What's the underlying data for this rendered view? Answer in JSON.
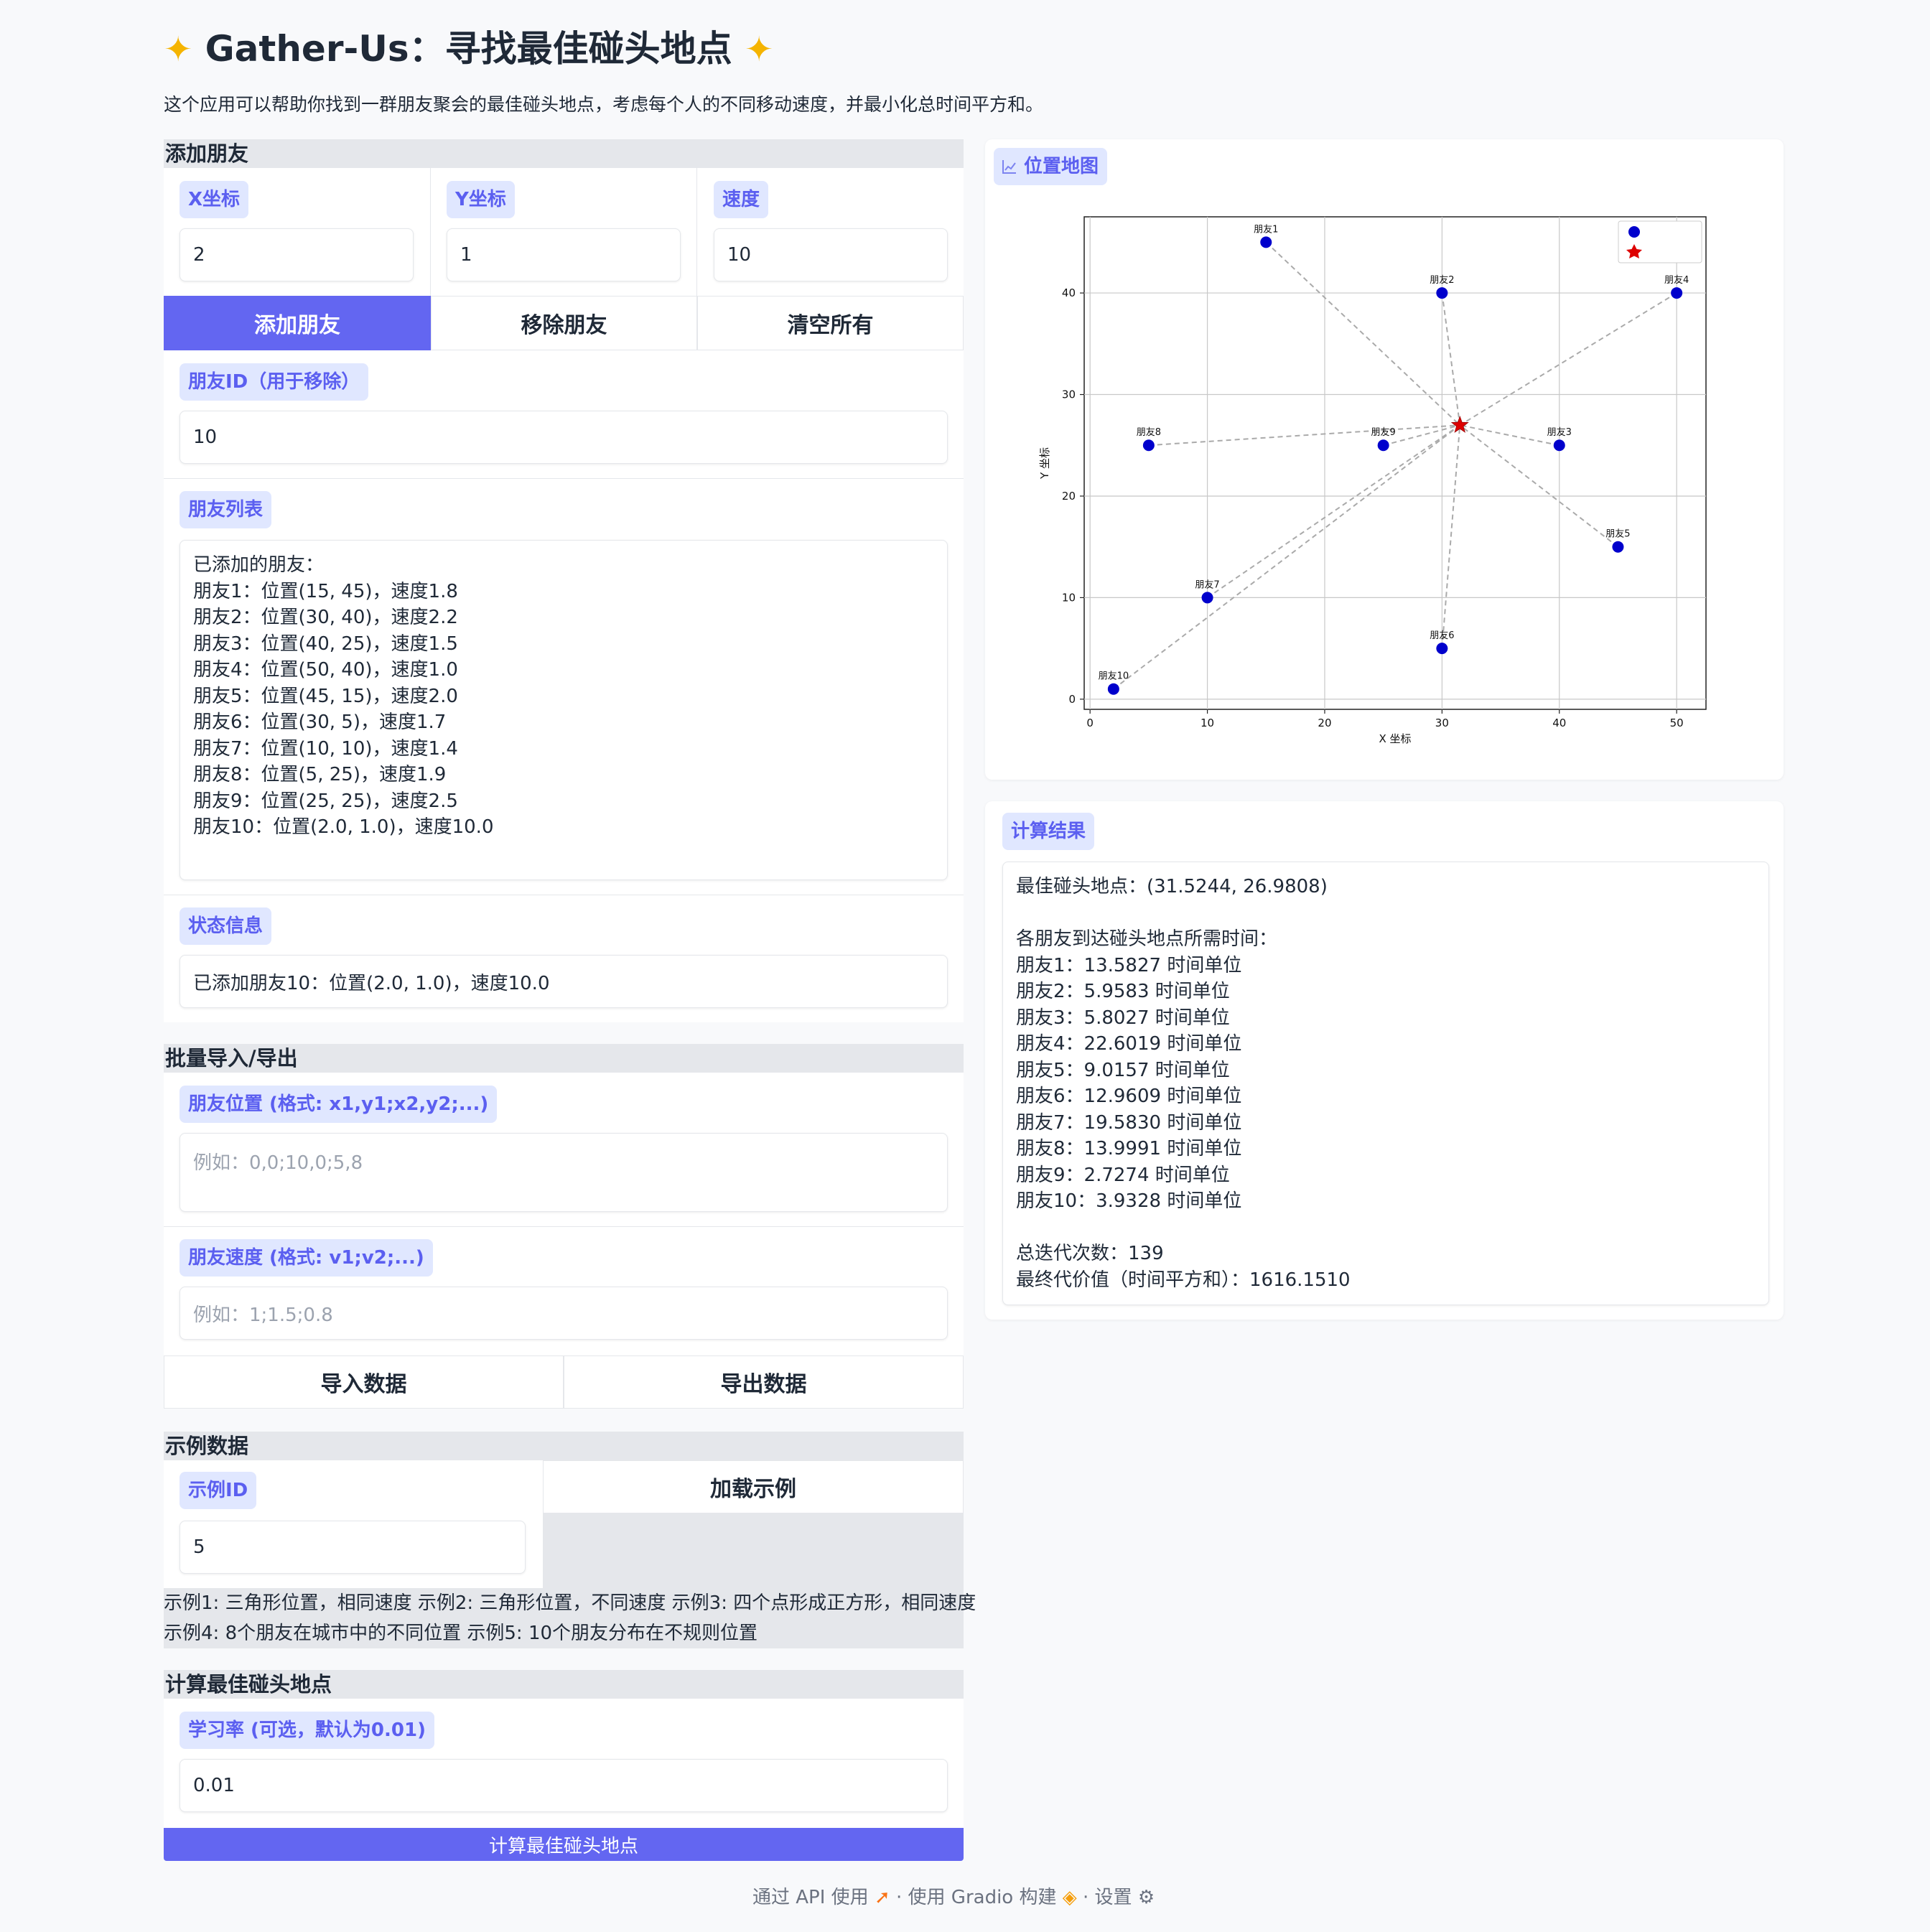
{
  "app": {
    "title": "Gather-Us：寻找最佳碰头地点",
    "title_icon": "glowing-star",
    "description": "这个应用可以帮助你找到一群朋友聚会的最佳碰头地点，考虑每个人的不同移动速度，并最小化总时间平方和。"
  },
  "add_friend": {
    "header": "添加朋友",
    "x_label": "X坐标",
    "x_value": "2",
    "y_label": "Y坐标",
    "y_value": "1",
    "speed_label": "速度",
    "speed_value": "10",
    "add_button": "添加朋友",
    "remove_button": "移除朋友",
    "clear_button": "清空所有",
    "id_label": "朋友ID（用于移除）",
    "id_value": "10",
    "list_label": "朋友列表",
    "list_value": "已添加的朋友：\n朋友1：位置(15, 45)，速度1.8\n朋友2：位置(30, 40)，速度2.2\n朋友3：位置(40, 25)，速度1.5\n朋友4：位置(50, 40)，速度1.0\n朋友5：位置(45, 15)，速度2.0\n朋友6：位置(30, 5)，速度1.7\n朋友7：位置(10, 10)，速度1.4\n朋友8：位置(5, 25)，速度1.9\n朋友9：位置(25, 25)，速度2.5\n朋友10：位置(2.0, 1.0)，速度10.0",
    "status_label": "状态信息",
    "status_value": "已添加朋友10：位置(2.0, 1.0)，速度10.0"
  },
  "batch": {
    "header": "批量导入/导出",
    "positions_label": "朋友位置 (格式: x1,y1;x2,y2;...)",
    "positions_placeholder": "例如：0,0;10,0;5,8",
    "speeds_label": "朋友速度 (格式: v1;v2;...)",
    "speeds_placeholder": "例如：1;1.5;0.8",
    "import_button": "导入数据",
    "export_button": "导出数据"
  },
  "examples": {
    "header": "示例数据",
    "id_label": "示例ID",
    "id_value": "5",
    "load_button": "加载示例",
    "description_line1": "示例1: 三角形位置，相同速度 示例2: 三角形位置，不同速度 示例3: 四个点形成正方形，相同速度",
    "description_line2": "示例4: 8个朋友在城市中的不同位置 示例5: 10个朋友分布在不规则位置"
  },
  "compute": {
    "header": "计算最佳碰头地点",
    "lr_label": "学习率 (可选，默认为0.01)",
    "lr_value": "0.01",
    "button": "计算最佳碰头地点"
  },
  "map": {
    "label": "位置地图",
    "icon": "chart-icon"
  },
  "results": {
    "label": "计算结果",
    "text": "最佳碰头地点：(31.5244, 26.9808)\n\n各朋友到达碰头地点所需时间：\n朋友1：13.5827 时间单位\n朋友2：5.9583 时间单位\n朋友3：5.8027 时间单位\n朋友4：22.6019 时间单位\n朋友5：9.0157 时间单位\n朋友6：12.9609 时间单位\n朋友7：19.5830 时间单位\n朋友8：13.9991 时间单位\n朋友9：2.7274 时间单位\n朋友10：3.9328 时间单位\n\n总迭代次数：139\n最终代价值（时间平方和）：1616.1510"
  },
  "footer": {
    "api": "通过 API 使用",
    "built": "使用 Gradio 构建",
    "settings": "设置",
    "separator": "·"
  },
  "chart_data": {
    "type": "scatter",
    "title": "",
    "xlabel": "X 坐标",
    "ylabel": "Y 坐标",
    "xlim": [
      -0.5,
      52.5
    ],
    "ylim": [
      -1,
      47.5
    ],
    "xticks": [
      0,
      10,
      20,
      30,
      40,
      50
    ],
    "yticks": [
      0,
      10,
      20,
      30,
      40
    ],
    "grid": true,
    "legend_position": "top-right",
    "legend": [
      "",
      ""
    ],
    "colors": {
      "friends": "#0000cc",
      "meeting": "#dd0000",
      "lines": "#aaaaaa"
    },
    "friends": [
      {
        "label": "朋友1",
        "x": 15,
        "y": 45
      },
      {
        "label": "朋友2",
        "x": 30,
        "y": 40
      },
      {
        "label": "朋友3",
        "x": 40,
        "y": 25
      },
      {
        "label": "朋友4",
        "x": 50,
        "y": 40
      },
      {
        "label": "朋友5",
        "x": 45,
        "y": 15
      },
      {
        "label": "朋友6",
        "x": 30,
        "y": 5
      },
      {
        "label": "朋友7",
        "x": 10,
        "y": 10
      },
      {
        "label": "朋友8",
        "x": 5,
        "y": 25
      },
      {
        "label": "朋友9",
        "x": 25,
        "y": 25
      },
      {
        "label": "朋友10",
        "x": 2,
        "y": 1
      }
    ],
    "meeting_point": {
      "x": 31.5244,
      "y": 26.9808
    }
  }
}
